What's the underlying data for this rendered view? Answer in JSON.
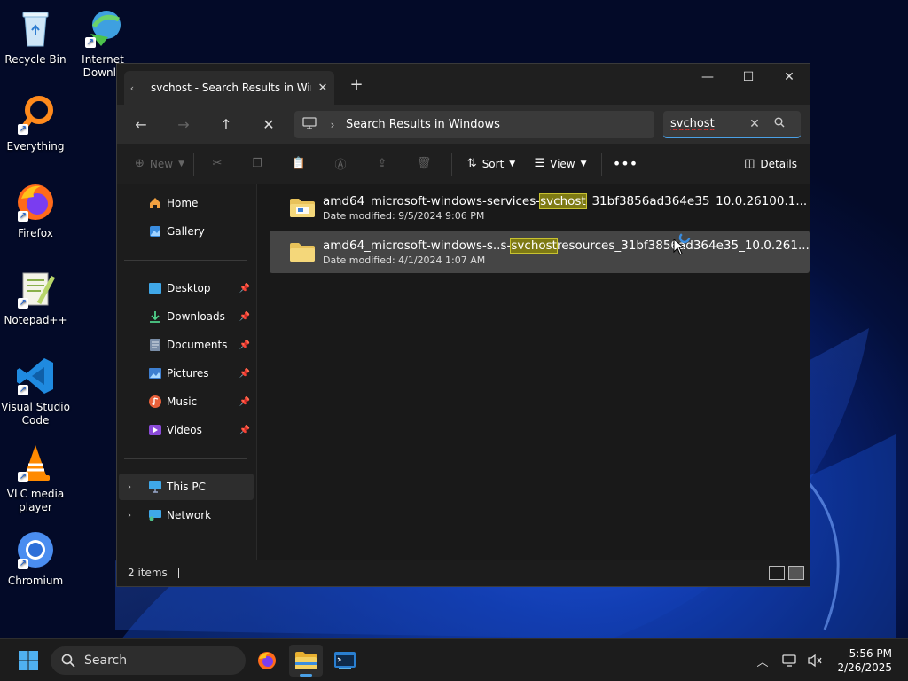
{
  "desktop": {
    "icons": [
      {
        "label": "Recycle Bin"
      },
      {
        "label": "Internet Downlo"
      },
      {
        "label": "Everything"
      },
      {
        "label": "Firefox"
      },
      {
        "label": "Notepad++"
      },
      {
        "label": "Visual Studio Code"
      },
      {
        "label": "VLC media player"
      },
      {
        "label": "Chromium"
      }
    ]
  },
  "window": {
    "tab_title": "svchost - Search Results in Wir",
    "address": {
      "crumb": "Search Results in Windows"
    },
    "search": {
      "value": "svchost"
    },
    "toolbar": {
      "new_label": "New",
      "sort_label": "Sort",
      "view_label": "View",
      "details_label": "Details"
    },
    "sidebar": {
      "home": "Home",
      "gallery": "Gallery",
      "desktop": "Desktop",
      "downloads": "Downloads",
      "documents": "Documents",
      "pictures": "Pictures",
      "music": "Music",
      "videos": "Videos",
      "this_pc": "This PC",
      "network": "Network"
    },
    "results": [
      {
        "name_pre": "amd64_microsoft-windows-services-",
        "name_hl": "svchost",
        "name_post": "_31bf3856ad364e35_10.0.26100.1...",
        "date": "Date modified: 9/5/2024 9:06 PM"
      },
      {
        "name_pre": "amd64_microsoft-windows-s..s-",
        "name_hl": "svchost",
        "name_post": "resources_31bf3856ad364e35_10.0.261...",
        "date": "Date modified: 4/1/2024 1:07 AM"
      }
    ],
    "status": {
      "count": "2 items"
    }
  },
  "taskbar": {
    "search_label": "Search",
    "time": "5:56 PM",
    "date": "2/26/2025"
  },
  "colors": {
    "accent": "#4aa0e6",
    "highlight": "#7e7a14",
    "folder": "#e8c25a"
  }
}
